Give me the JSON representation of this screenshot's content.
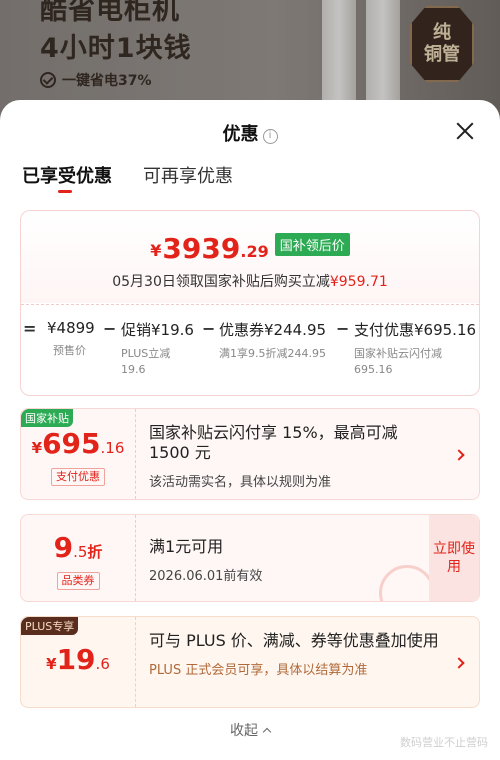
{
  "banner": {
    "headline_line1": "酷省电柜机",
    "headline_line2": "4小时1块钱",
    "subline": "一键省电37%",
    "badge_line1": "纯",
    "badge_line2": "铜管"
  },
  "sheet": {
    "title": "优惠",
    "tabs": [
      "已享受优惠",
      "可再享优惠"
    ]
  },
  "price": {
    "symbol": "¥",
    "integer": "3939",
    "decimal": ".29",
    "tag": "国补领后价",
    "note_prefix": "05月30日领取国家补贴后购买立减",
    "note_amount": "¥959.71"
  },
  "calc": {
    "items": [
      {
        "op": "=",
        "value": "¥4899",
        "desc": "预售价"
      },
      {
        "op": "−",
        "value": "促销¥19.6",
        "desc": "PLUS立减 19.6"
      },
      {
        "op": "−",
        "value": "优惠券¥244.95",
        "desc": "满1享9.5折减244.95"
      },
      {
        "op": "−",
        "value": "支付优惠¥695.16",
        "desc": "国家补贴云闪付减 695.16"
      }
    ]
  },
  "coupons": [
    {
      "label": "国家补贴",
      "symbol": "¥",
      "integer": "695",
      "decimal": ".16",
      "type": "支付优惠",
      "headline": "国家补贴云闪付享 15%，最高可减 1500 元",
      "sub": "该活动需实名，具体以规则为准"
    },
    {
      "label": "",
      "symbol": "",
      "integer": "9",
      "decimal": ".5",
      "unit": "折",
      "type": "品类券",
      "headline": "满1元可用",
      "sub": "2026.06.01前有效",
      "action": "立即使用"
    },
    {
      "label": "PLUS专享",
      "symbol": "¥",
      "integer": "19",
      "decimal": ".6",
      "headline": "可与 PLUS 价、满减、券等优惠叠加使用",
      "sub": "PLUS 正式会员可享，具体以结算为准"
    }
  ],
  "footer": {
    "collapse": "收起",
    "watermark": "数码营业不止营码"
  },
  "colors": {
    "accent_red": "#e2231a",
    "green_tag": "#2daa54",
    "plus_brown": "#5a2e1e"
  }
}
